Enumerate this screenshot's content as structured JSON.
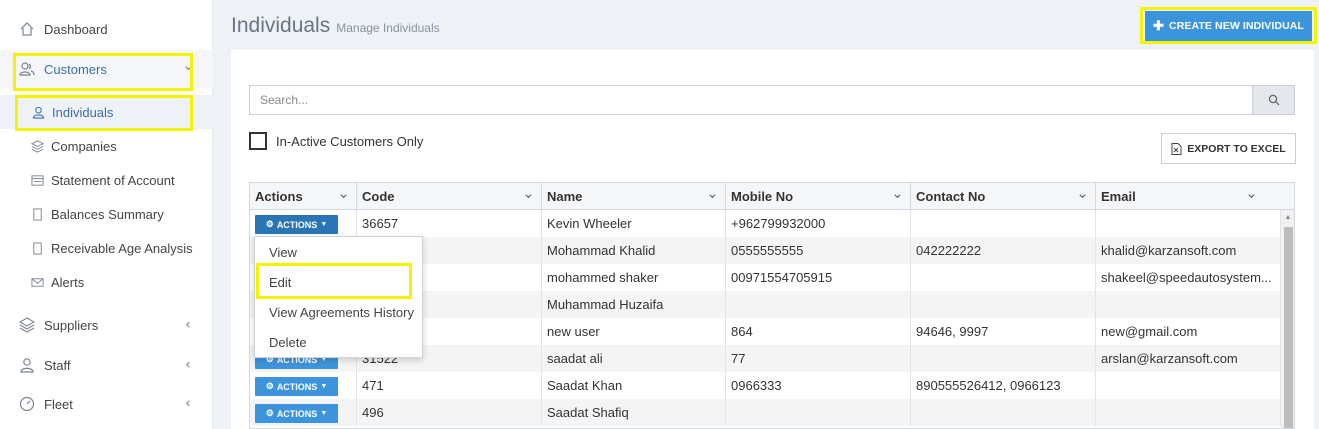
{
  "sidebar": {
    "items": [
      {
        "label": "Dashboard",
        "icon": "home-icon"
      },
      {
        "label": "Customers",
        "icon": "users-icon"
      },
      {
        "label": "Suppliers",
        "icon": "layers-icon"
      },
      {
        "label": "Staff",
        "icon": "user-icon"
      },
      {
        "label": "Fleet",
        "icon": "speedometer-icon"
      }
    ],
    "customers_sub": [
      {
        "label": "Individuals",
        "icon": "user-icon"
      },
      {
        "label": "Companies",
        "icon": "layers-icon"
      },
      {
        "label": "Statement of Account",
        "icon": "statement-icon"
      },
      {
        "label": "Balances Summary",
        "icon": "document-icon"
      },
      {
        "label": "Receivable Age Analysis",
        "icon": "document-icon"
      },
      {
        "label": "Alerts",
        "icon": "envelope-icon"
      }
    ]
  },
  "header": {
    "title": "Individuals",
    "subtitle": "Manage Individuals",
    "create_label": "CREATE NEW INDIVIDUAL"
  },
  "search": {
    "placeholder": "Search..."
  },
  "filter": {
    "inactive_label": "In-Active Customers Only",
    "checked": false
  },
  "export_label": "EXPORT TO EXCEL",
  "table": {
    "columns": [
      "Actions",
      "Code",
      "Name",
      "Mobile No",
      "Contact No",
      "Email"
    ],
    "action_label": "ACTIONS",
    "rows": [
      {
        "code": "36657",
        "name": "Kevin Wheeler",
        "mobile": "+962799932000",
        "contact": "",
        "email": ""
      },
      {
        "code": "",
        "name": "Mohammad Khalid",
        "mobile": "0555555555",
        "contact": "042222222",
        "email": "khalid@karzansoft.com"
      },
      {
        "code": "",
        "name": "mohammed shaker",
        "mobile": "00971554705915",
        "contact": "",
        "email": "shakeel@speedautosystem..."
      },
      {
        "code": "",
        "name": "Muhammad Huzaifa",
        "mobile": "",
        "contact": "",
        "email": ""
      },
      {
        "code": "",
        "name": "new user",
        "mobile": "864",
        "contact": "94646, 9997",
        "email": "new@gmail.com"
      },
      {
        "code": "31522",
        "name": "saadat ali",
        "mobile": "77",
        "contact": "",
        "email": "arslan@karzansoft.com"
      },
      {
        "code": "471",
        "name": "Saadat Khan",
        "mobile": "0966333",
        "contact": "890555526412, 0966123",
        "email": ""
      },
      {
        "code": "496",
        "name": "Saadat Shafiq",
        "mobile": "",
        "contact": "",
        "email": ""
      }
    ]
  },
  "action_menu": {
    "items": [
      "View",
      "Edit",
      "View Agreements History",
      "Delete"
    ]
  },
  "colors": {
    "accent": "#3c95dc",
    "highlight": "#f4f400"
  }
}
